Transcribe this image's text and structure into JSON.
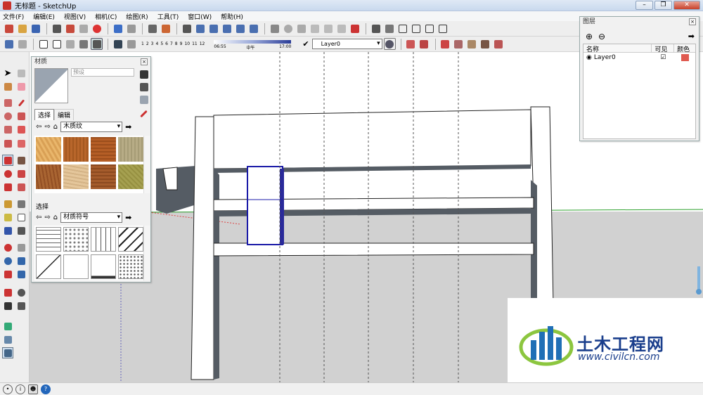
{
  "window": {
    "title": "无标题 - SketchUp"
  },
  "menu": [
    "文件(F)",
    "编辑(E)",
    "视图(V)",
    "相机(C)",
    "绘图(R)",
    "工具(T)",
    "窗口(W)",
    "帮助(H)"
  ],
  "toolbar": {
    "shadow_months": [
      "1",
      "2",
      "3",
      "4",
      "5",
      "6",
      "7",
      "8",
      "9",
      "10",
      "11",
      "12"
    ],
    "time_start": "06:55",
    "time_mid": "中午",
    "time_end": "17:00",
    "layer_current": "Layer0"
  },
  "materials_panel": {
    "title": "材质",
    "name_placeholder": "预设",
    "tabs": [
      "选择",
      "编辑"
    ],
    "library": "木质纹",
    "select_label": "选择",
    "library2": "材质符号",
    "wood_swatches": [
      "#e9b66b",
      "#b8662b",
      "#b55e26",
      "#b7ac86",
      "#a96532",
      "#e4c69b",
      "#a55c2c",
      "#a5a050"
    ],
    "pattern_swatches": [
      "cobble",
      "stone",
      "grid",
      "hatch-dark",
      "slash",
      "blank",
      "blank-line",
      "dots"
    ]
  },
  "layers_panel": {
    "title": "图层",
    "col_name": "名称",
    "col_visible": "可见",
    "col_color": "颜色",
    "row_name": "Layer0",
    "row_color": "#e05a50"
  },
  "watermark": {
    "name": "土木工程网",
    "url": "www.civilcn.com"
  },
  "colors": {
    "dash_line": "#555555",
    "beam_fill": "#ffffff",
    "selection": "#1a1aa8",
    "ground": "#d1d1d1",
    "sky": "#ffffff",
    "horizon": "#2ca02c"
  }
}
